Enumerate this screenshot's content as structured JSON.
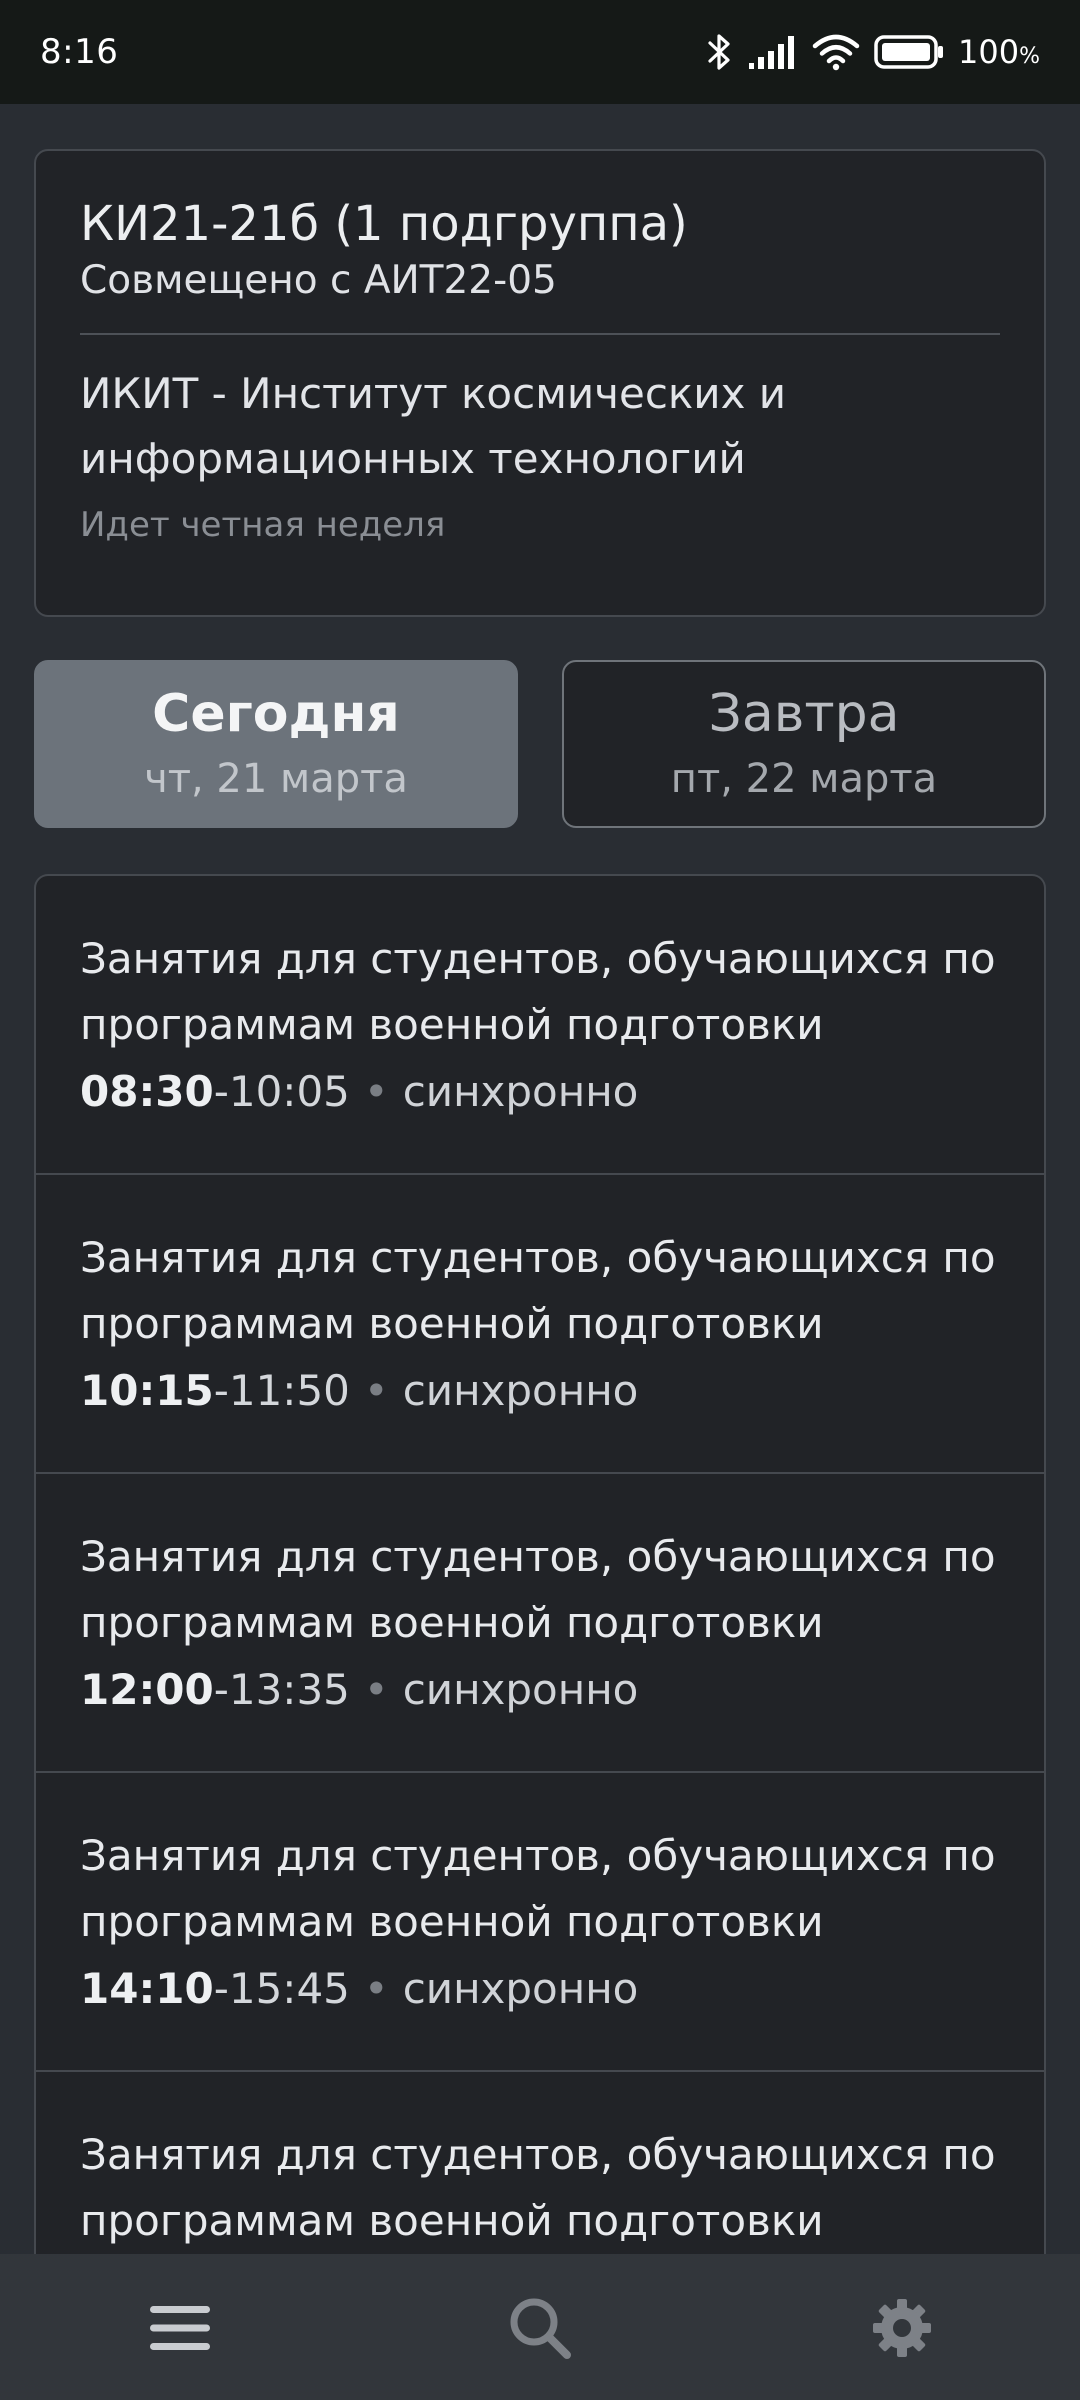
{
  "status_bar": {
    "time": "8:16",
    "battery_percent": "100",
    "battery_unit": "%",
    "icons": [
      "bluetooth-icon",
      "cellular-signal-icon",
      "wifi-icon",
      "battery-icon"
    ]
  },
  "group": {
    "title": "КИ21-21б (1 подгруппа)",
    "combined": "Совмещено с АИТ22-05",
    "institute": "ИКИТ - Институт космических и информационных технологий",
    "week": "Идет четная неделя"
  },
  "day_tabs": [
    {
      "title": "Сегодня",
      "date": "чт, 21 марта",
      "active": true
    },
    {
      "title": "Завтра",
      "date": "пт, 22 марта",
      "active": false
    }
  ],
  "lessons": [
    {
      "title": "Занятия для студентов, обучающихся по программам военной подготовки",
      "start": "08:30",
      "end": "10:05",
      "mode": "синхронно"
    },
    {
      "title": "Занятия для студентов, обучающихся по программам военной подготовки",
      "start": "10:15",
      "end": "11:50",
      "mode": "синхронно"
    },
    {
      "title": "Занятия для студентов, обучающихся по программам военной подготовки",
      "start": "12:00",
      "end": "13:35",
      "mode": "синхронно"
    },
    {
      "title": "Занятия для студентов, обучающихся по программам военной подготовки",
      "start": "14:10",
      "end": "15:45",
      "mode": "синхронно"
    },
    {
      "title": "Занятия для студентов, обучающихся по программам военной подготовки"
    }
  ],
  "bottom_nav": {
    "items": [
      "menu-icon",
      "search-icon",
      "gear-icon"
    ]
  },
  "colors": {
    "background": "#292d33",
    "card": "#212327",
    "active_tab": "#6c737b",
    "nav_bar": "#32363b",
    "status_bar": "#151917"
  }
}
